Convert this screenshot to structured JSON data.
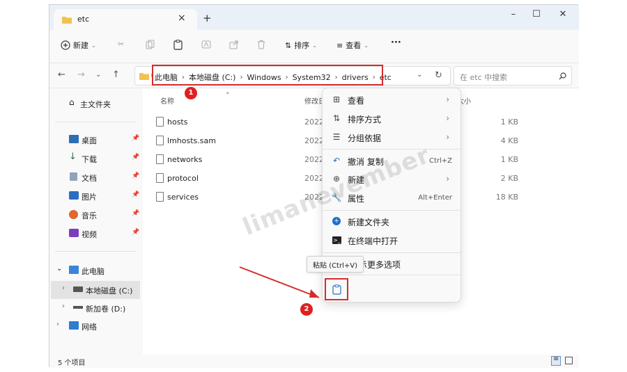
{
  "window": {
    "tab_title": "etc",
    "tab_close": "×",
    "new_tab": "+",
    "minimize": "–",
    "maximize": "☐",
    "close": "✕"
  },
  "toolbar": {
    "new_label": "新建",
    "sort_label": "排序",
    "view_label": "查看",
    "more_label": "···"
  },
  "address": {
    "breadcrumbs": [
      "此电脑",
      "本地磁盘 (C:)",
      "Windows",
      "System32",
      "drivers",
      "etc"
    ],
    "search_placeholder": "在 etc 中搜索"
  },
  "sidebar": {
    "home": "主文件夹",
    "quick": [
      {
        "label": "桌面"
      },
      {
        "label": "下载"
      },
      {
        "label": "文档"
      },
      {
        "label": "图片"
      },
      {
        "label": "音乐"
      },
      {
        "label": "视频"
      }
    ],
    "this_pc": "此电脑",
    "drive_c": "本地磁盘 (C:)",
    "drive_d": "新加卷 (D:)",
    "network": "网络"
  },
  "columns": {
    "name": "名称",
    "modified": "修改日",
    "size": "大小"
  },
  "files": [
    {
      "name": "hosts",
      "date": "2022/",
      "size": "1 KB"
    },
    {
      "name": "lmhosts.sam",
      "date": "2022/",
      "size": "4 KB"
    },
    {
      "name": "networks",
      "date": "2022/",
      "size": "1 KB"
    },
    {
      "name": "protocol",
      "date": "2022/",
      "size": "2 KB"
    },
    {
      "name": "services",
      "date": "2022/",
      "size": "18 KB"
    }
  ],
  "status": {
    "count": "5 个项目"
  },
  "context_menu": {
    "view": "查看",
    "sort": "排序方式",
    "group": "分组依据",
    "undo": "撤消 复制",
    "undo_shortcut": "Ctrl+Z",
    "new": "新建",
    "properties": "属性",
    "properties_shortcut": "Alt+Enter",
    "new_folder": "新建文件夹",
    "open_terminal": "在终端中打开",
    "more_options": "示更多选项"
  },
  "tooltip": "粘贴 (Ctrl+V)",
  "annotations": {
    "badge1": "1",
    "badge2": "2",
    "accent": "#d62b2b"
  },
  "watermark": "limanevember"
}
